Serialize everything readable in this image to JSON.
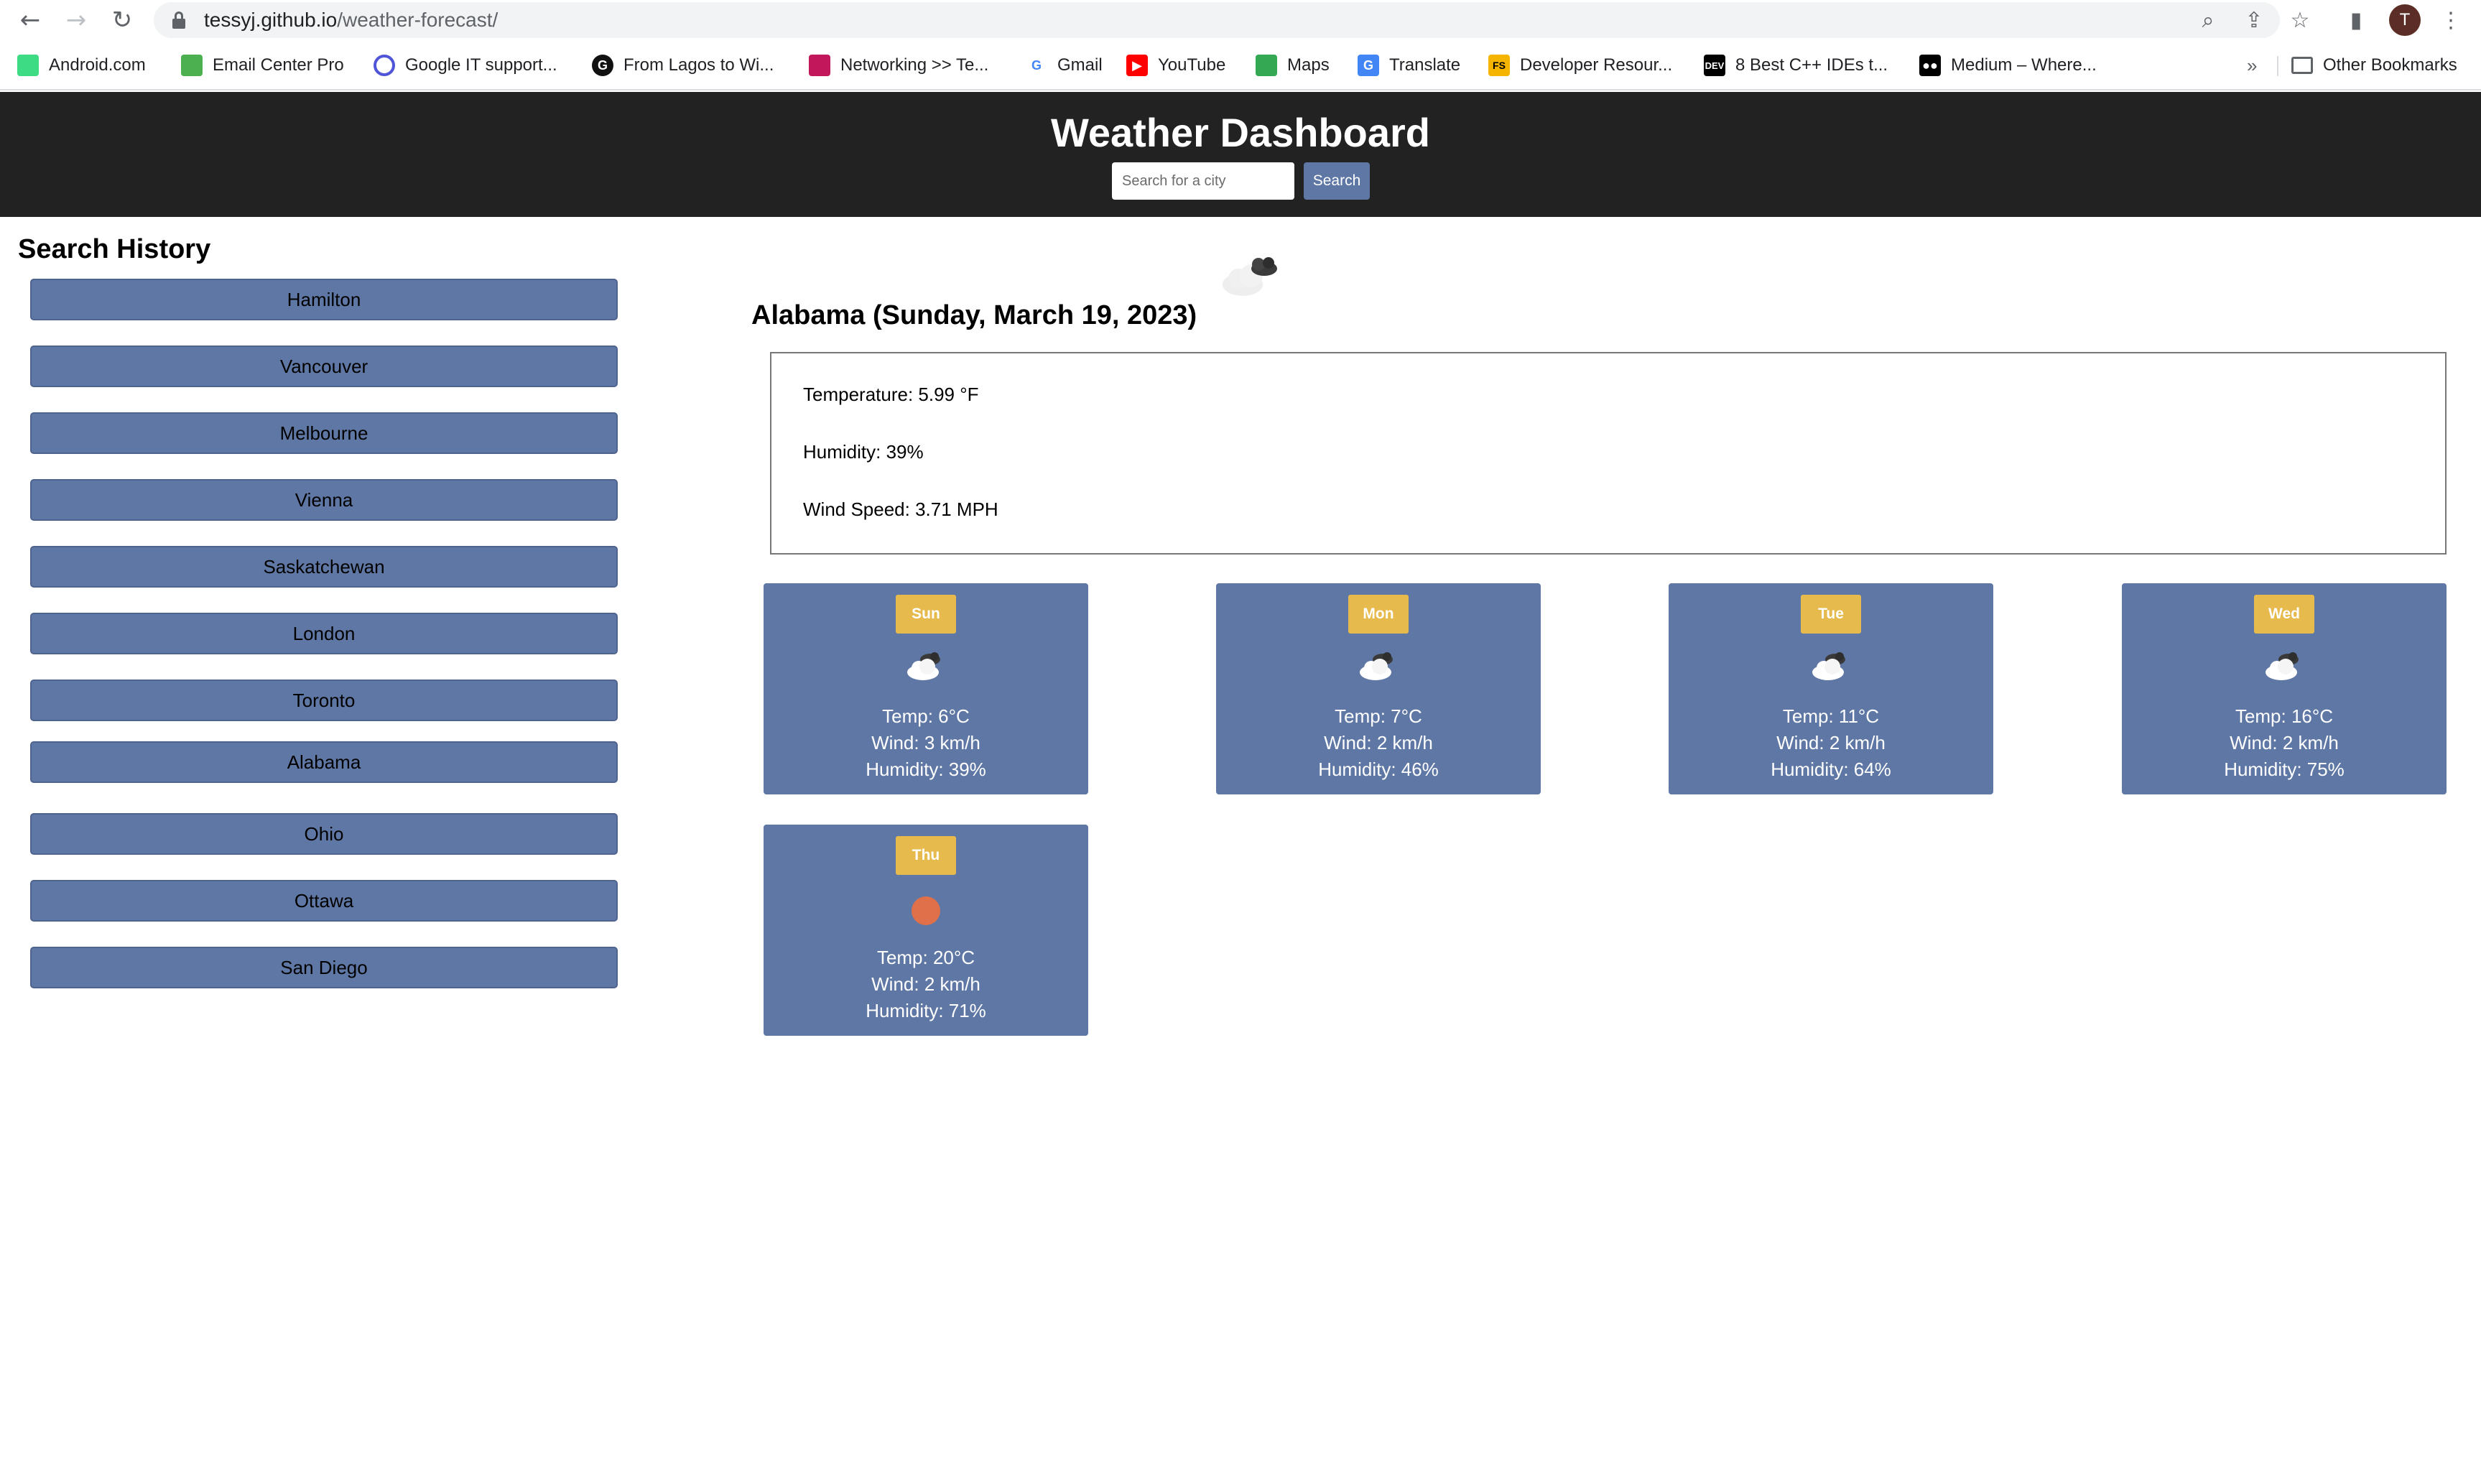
{
  "browser": {
    "url_host": "tessyj.github.io",
    "url_path": "/weather-forecast/",
    "profile_initial": "T",
    "bookmarks": [
      {
        "label": "Android.com",
        "icon": "android-icon",
        "color": "#3ddc84"
      },
      {
        "label": "Email Center Pro",
        "icon": "email-center-icon",
        "color": "#4caf50"
      },
      {
        "label": "Google IT support...",
        "icon": "q-icon",
        "color": "#4f55d6"
      },
      {
        "label": "From Lagos to Wi...",
        "icon": "medium-g-icon",
        "color": "#111111"
      },
      {
        "label": "Networking >> Te...",
        "icon": "networking-icon",
        "color": "#c2185b"
      },
      {
        "label": "Gmail",
        "icon": "google-icon",
        "color": "#4285f4"
      },
      {
        "label": "YouTube",
        "icon": "youtube-icon",
        "color": "#ff0000"
      },
      {
        "label": "Maps",
        "icon": "maps-icon",
        "color": "#34a853"
      },
      {
        "label": "Translate",
        "icon": "translate-icon",
        "color": "#4285f4"
      },
      {
        "label": "Developer Resour...",
        "icon": "fs-icon",
        "color": "#f4b400"
      },
      {
        "label": "8 Best C++ IDEs t...",
        "icon": "dev-icon",
        "color": "#000000"
      },
      {
        "label": "Medium – Where...",
        "icon": "medium-icon",
        "color": "#000000"
      }
    ],
    "overflow": "»",
    "other_bookmarks": "Other Bookmarks"
  },
  "header": {
    "title": "Weather Dashboard",
    "search_placeholder": "Search for a city",
    "search_button": "Search"
  },
  "history": {
    "title": "Search History",
    "items": [
      "Hamilton",
      "Vancouver",
      "Melbourne",
      "Vienna",
      "Saskatchewan",
      "London",
      "Toronto",
      "Alabama",
      "Ohio",
      "Ottawa",
      "San Diego"
    ]
  },
  "current": {
    "title": "Alabama (Sunday, March 19, 2023)",
    "icon": "broken-clouds-icon",
    "temperature": "Temperature: 5.99 °F",
    "humidity": "Humidity: 39%",
    "wind": "Wind Speed: 3.71 MPH"
  },
  "forecast": [
    {
      "day": "Sun",
      "icon": "cloud-icon",
      "temp": "Temp: 6°C",
      "wind": "Wind: 3 km/h",
      "humidity": "Humidity: 39%"
    },
    {
      "day": "Mon",
      "icon": "cloud-icon",
      "temp": "Temp: 7°C",
      "wind": "Wind: 2 km/h",
      "humidity": "Humidity: 46%"
    },
    {
      "day": "Tue",
      "icon": "cloud-icon",
      "temp": "Temp: 11°C",
      "wind": "Wind: 2 km/h",
      "humidity": "Humidity: 64%"
    },
    {
      "day": "Wed",
      "icon": "cloud-icon",
      "temp": "Temp: 16°C",
      "wind": "Wind: 2 km/h",
      "humidity": "Humidity: 75%"
    },
    {
      "day": "Thu",
      "icon": "sun-icon",
      "temp": "Temp: 20°C",
      "wind": "Wind: 2 km/h",
      "humidity": "Humidity: 71%"
    }
  ],
  "colors": {
    "header_bg": "#222222",
    "accent_blue": "#5f77a4",
    "badge_yellow": "#e7ba4e",
    "sun": "#e0704a"
  }
}
